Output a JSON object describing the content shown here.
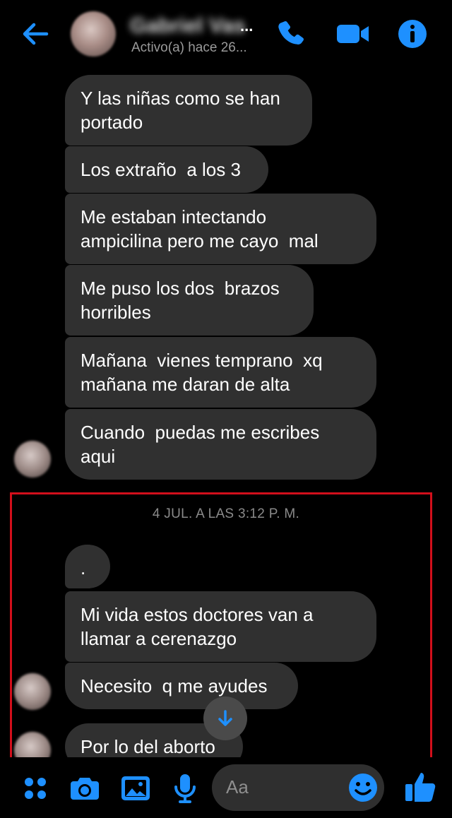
{
  "colors": {
    "accent": "#1e90ff",
    "bubble": "#303030",
    "background": "#000000",
    "highlight": "#d20f1b"
  },
  "header": {
    "contact_name": "Gabriel Vas",
    "name_ellipsis": "...",
    "status": "Activo(a) hace 26...",
    "icons": [
      "back-arrow-icon",
      "phone-icon",
      "video-camera-icon",
      "info-icon"
    ]
  },
  "messages": [
    {
      "text": "Y las niñas como se han\nportado"
    },
    {
      "text": "Los extraño  a los 3"
    },
    {
      "text": "Me estaban intectando\nampicilina pero me cayo  mal"
    },
    {
      "text": "Me puso los dos  brazos\nhorribles"
    },
    {
      "text": "Mañana  vienes temprano  xq\nmañana me daran de alta"
    },
    {
      "text": "Cuando  puedas me escribes\naqui"
    }
  ],
  "timestamp": "4 JUL. A LAS 3:12 P. M.",
  "messages_after": [
    {
      "text": "."
    },
    {
      "text": "Mi vida estos doctores van a\nllamar a cerenazgo"
    },
    {
      "text": "Necesito  q me ayudes"
    },
    {
      "text": "Por lo del aborto"
    }
  ],
  "composer": {
    "placeholder": "Aa",
    "icons": [
      "apps-grid-icon",
      "camera-icon",
      "gallery-icon",
      "microphone-icon",
      "emoji-icon",
      "thumbs-up-icon"
    ]
  }
}
